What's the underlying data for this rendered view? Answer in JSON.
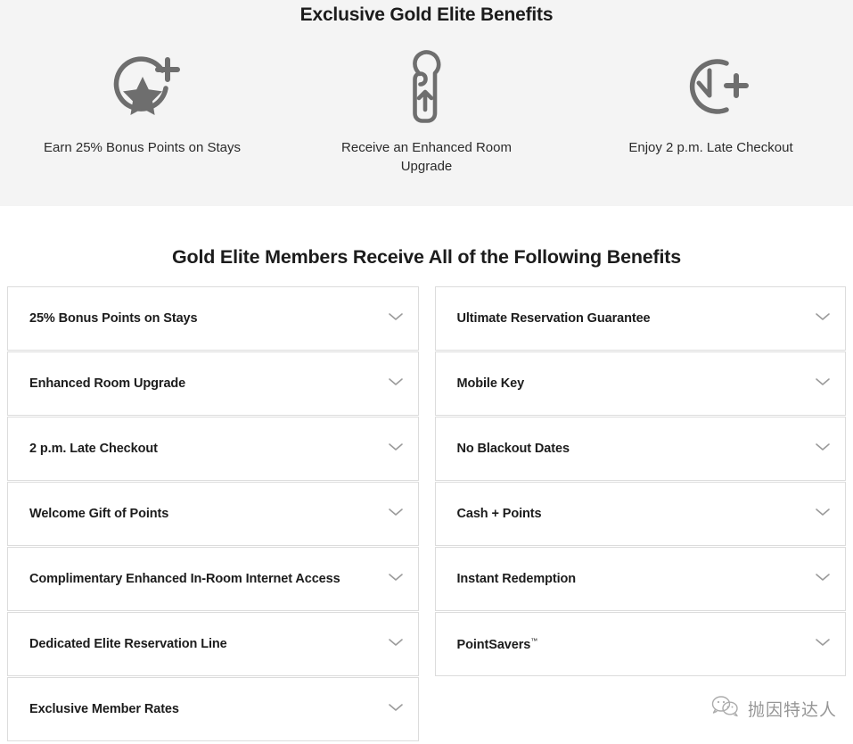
{
  "hero": {
    "title": "Exclusive Gold Elite Benefits",
    "background_color": "#f4f4f4",
    "icon_color": "#6e6e6e",
    "highlights": [
      {
        "icon": "star-circle-plus-icon",
        "caption": "Earn 25% Bonus Points on Stays"
      },
      {
        "icon": "door-hanger-up-arrow-icon",
        "caption": "Receive an Enhanced Room Upgrade"
      },
      {
        "icon": "clock-plus-icon",
        "caption": "Enjoy 2 p.m. Late Checkout"
      }
    ]
  },
  "main": {
    "heading": "Gold Elite Members Receive All of the Following Benefits",
    "chevron_icon": "chevron-down-icon",
    "chevron_color": "#9b9b9b",
    "border_color": "#dcdcdc",
    "left_column": [
      {
        "label": "25% Bonus Points on Stays"
      },
      {
        "label": "Enhanced Room Upgrade"
      },
      {
        "label": "2 p.m. Late Checkout"
      },
      {
        "label": "Welcome Gift of Points"
      },
      {
        "label": "Complimentary Enhanced In-Room Internet Access"
      },
      {
        "label": "Dedicated Elite Reservation Line"
      },
      {
        "label": "Exclusive Member Rates"
      }
    ],
    "right_column": [
      {
        "label": "Ultimate Reservation Guarantee"
      },
      {
        "label": "Mobile Key"
      },
      {
        "label": "No Blackout Dates"
      },
      {
        "label": "Cash + Points"
      },
      {
        "label": "Instant Redemption"
      },
      {
        "label": "PointSavers",
        "trademark": "™"
      }
    ]
  },
  "watermark": {
    "icon": "wechat-logo-icon",
    "text": "抛因特达人",
    "color": "#6f6f6f"
  }
}
